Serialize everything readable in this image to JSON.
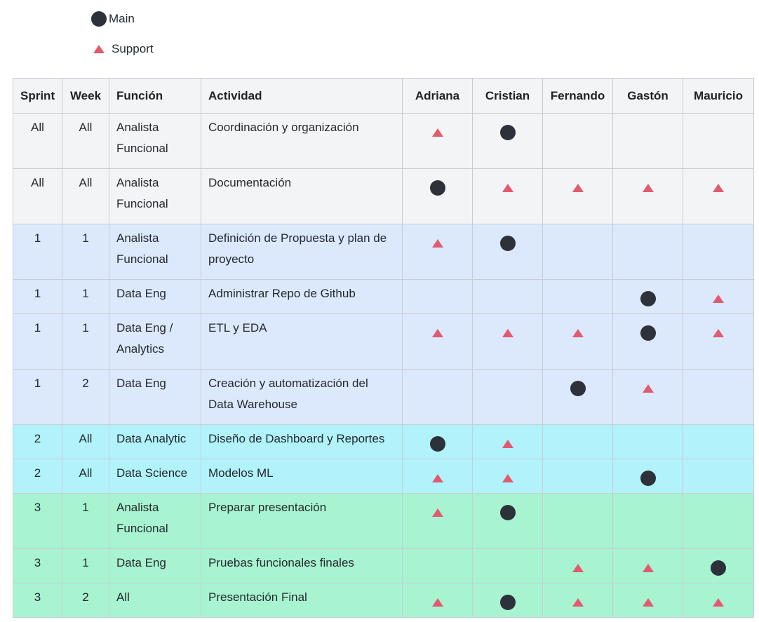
{
  "legend": {
    "main_label": "Main",
    "support_label": "Support"
  },
  "colors": {
    "main": "#2d3139",
    "support": "#e05b6f"
  },
  "table": {
    "headers": {
      "sprint": "Sprint",
      "week": "Week",
      "funcion": "Función",
      "actividad": "Actividad",
      "adriana": "Adriana",
      "cristian": "Cristian",
      "fernando": "Fernando",
      "gaston": "Gastón",
      "mauricio": "Mauricio"
    },
    "rows": [
      {
        "sprint": "All",
        "week": "All",
        "funcion": "Analista Funcional",
        "actividad": "Coordinación y organización",
        "roles": [
          "support",
          "main",
          "",
          "",
          ""
        ]
      },
      {
        "sprint": "All",
        "week": "All",
        "funcion": "Analista Funcional",
        "actividad": "Documentación",
        "roles": [
          "main",
          "support",
          "support",
          "support",
          "support"
        ]
      },
      {
        "sprint": "1",
        "week": "1",
        "funcion": "Analista Funcional",
        "actividad": "Definición de Propuesta y plan de proyecto",
        "roles": [
          "support",
          "main",
          "",
          "",
          ""
        ]
      },
      {
        "sprint": "1",
        "week": "1",
        "funcion": "Data Eng",
        "actividad": "Administrar Repo de Github",
        "roles": [
          "",
          "",
          "",
          "main",
          "support"
        ]
      },
      {
        "sprint": "1",
        "week": "1",
        "funcion": "Data Eng / Analytics",
        "actividad": "ETL y EDA",
        "roles": [
          "support",
          "support",
          "support",
          "main",
          "support"
        ]
      },
      {
        "sprint": "1",
        "week": "2",
        "funcion": "Data Eng",
        "actividad": "Creación y automatización del Data Warehouse",
        "roles": [
          "",
          "",
          "main",
          "support",
          ""
        ]
      },
      {
        "sprint": "2",
        "week": "All",
        "funcion": "Data Analytic",
        "actividad": "Diseño de Dashboard y Reportes",
        "roles": [
          "main",
          "support",
          "",
          "",
          ""
        ]
      },
      {
        "sprint": "2",
        "week": "All",
        "funcion": "Data Science",
        "actividad": "Modelos ML",
        "roles": [
          "support",
          "support",
          "",
          "main",
          ""
        ]
      },
      {
        "sprint": "3",
        "week": "1",
        "funcion": "Analista Funcional",
        "actividad": "Preparar presentación",
        "roles": [
          "support",
          "main",
          "",
          "",
          ""
        ]
      },
      {
        "sprint": "3",
        "week": "1",
        "funcion": "Data Eng",
        "actividad": "Pruebas funcionales finales",
        "roles": [
          "",
          "",
          "support",
          "support",
          "main"
        ]
      },
      {
        "sprint": "3",
        "week": "2",
        "funcion": "All",
        "actividad": "Presentación Final",
        "roles": [
          "support",
          "main",
          "support",
          "support",
          "support"
        ]
      }
    ]
  }
}
